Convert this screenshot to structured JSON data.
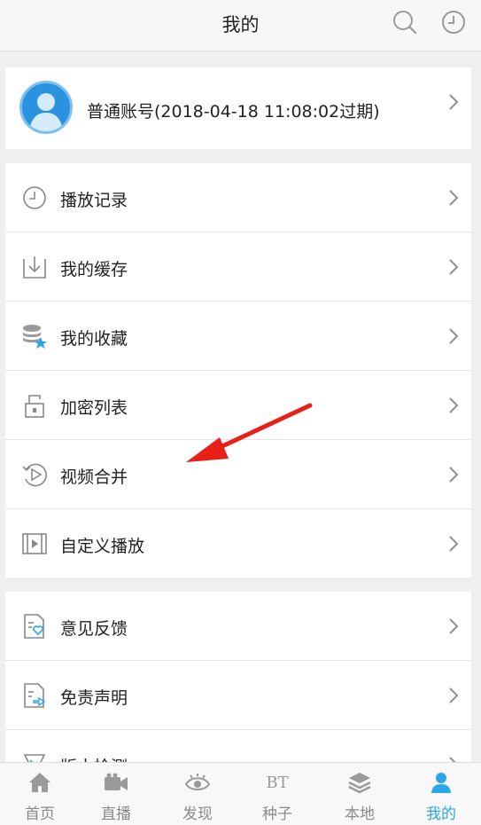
{
  "header": {
    "title": "我的"
  },
  "account": {
    "text": "普通账号(2018-04-18 11:08:02过期)"
  },
  "menu_group1": [
    {
      "label": "播放记录",
      "icon": "history-clock-icon"
    },
    {
      "label": "我的缓存",
      "icon": "download-tray-icon"
    },
    {
      "label": "我的收藏",
      "icon": "favorites-database-star-icon"
    },
    {
      "label": "加密列表",
      "icon": "lock-folder-icon"
    },
    {
      "label": "视频合并",
      "icon": "video-merge-icon"
    },
    {
      "label": "自定义播放",
      "icon": "film-strip-icon"
    }
  ],
  "menu_group2": [
    {
      "label": "意见反馈",
      "icon": "feedback-doc-heart-icon"
    },
    {
      "label": "免责声明",
      "icon": "disclaimer-doc-icon"
    },
    {
      "label": "版本检测",
      "icon": "version-check-icon"
    }
  ],
  "tabs": [
    {
      "label": "首页",
      "icon": "home-icon"
    },
    {
      "label": "直播",
      "icon": "video-camera-icon"
    },
    {
      "label": "发现",
      "icon": "eye-icon"
    },
    {
      "label": "种子",
      "icon": "bt-icon",
      "icon_text": "BT"
    },
    {
      "label": "本地",
      "icon": "layers-icon"
    },
    {
      "label": "我的",
      "icon": "user-icon",
      "active": true
    }
  ],
  "colors": {
    "accent": "#2aa7e8",
    "arrow": "#e8201a",
    "avatar": "#2a93e0"
  }
}
